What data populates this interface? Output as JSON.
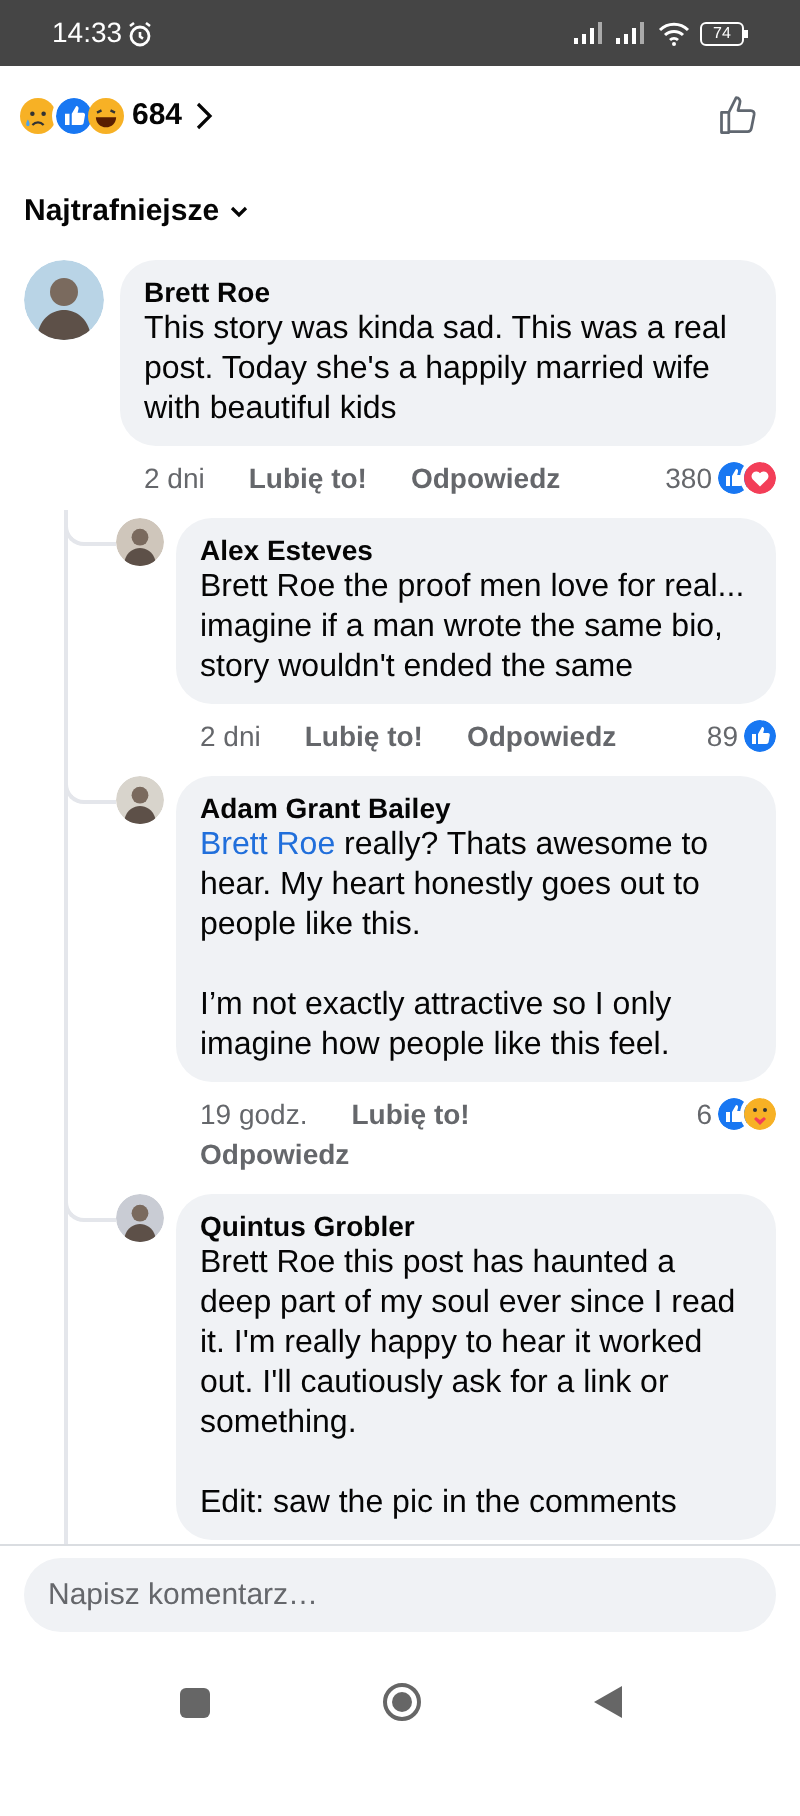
{
  "status_bar": {
    "time": "14:33",
    "battery": "74"
  },
  "header": {
    "reaction_count": "684"
  },
  "sort": {
    "label": "Najtrafniejsze"
  },
  "comment": {
    "author": "Brett Roe",
    "text": "This story was kinda sad. This was a real post. Today she's a happily married wife with beautiful kids",
    "time": "2 dni",
    "like": "Lubię to!",
    "reply": "Odpowiedz",
    "count": "380",
    "replies": [
      {
        "author": "Alex Esteves",
        "text": "Brett Roe the proof men love for real... imagine if a man wrote the same bio, story wouldn't ended the same",
        "time": "2 dni",
        "like": "Lubię to!",
        "reply": "Odpowiedz",
        "count": "89"
      },
      {
        "author": "Adam Grant Bailey",
        "mention": "Brett Roe",
        "text": " really? Thats awesome to hear. My heart honestly goes out to people like this.\n\nI’m not exactly attractive so I only imagine how people like this feel.",
        "time": "19 godz.",
        "like": "Lubię to!",
        "reply": "Odpowiedz",
        "count": "6"
      },
      {
        "author": "Quintus Grobler",
        "text": "Brett Roe this post has haunted a deep part of my soul ever since I read it. I'm really happy to hear it worked out. I'll cautiously ask for a link or something.\n\nEdit: saw the pic in the comments"
      }
    ]
  },
  "composer": {
    "placeholder": "Napisz komentarz…"
  }
}
